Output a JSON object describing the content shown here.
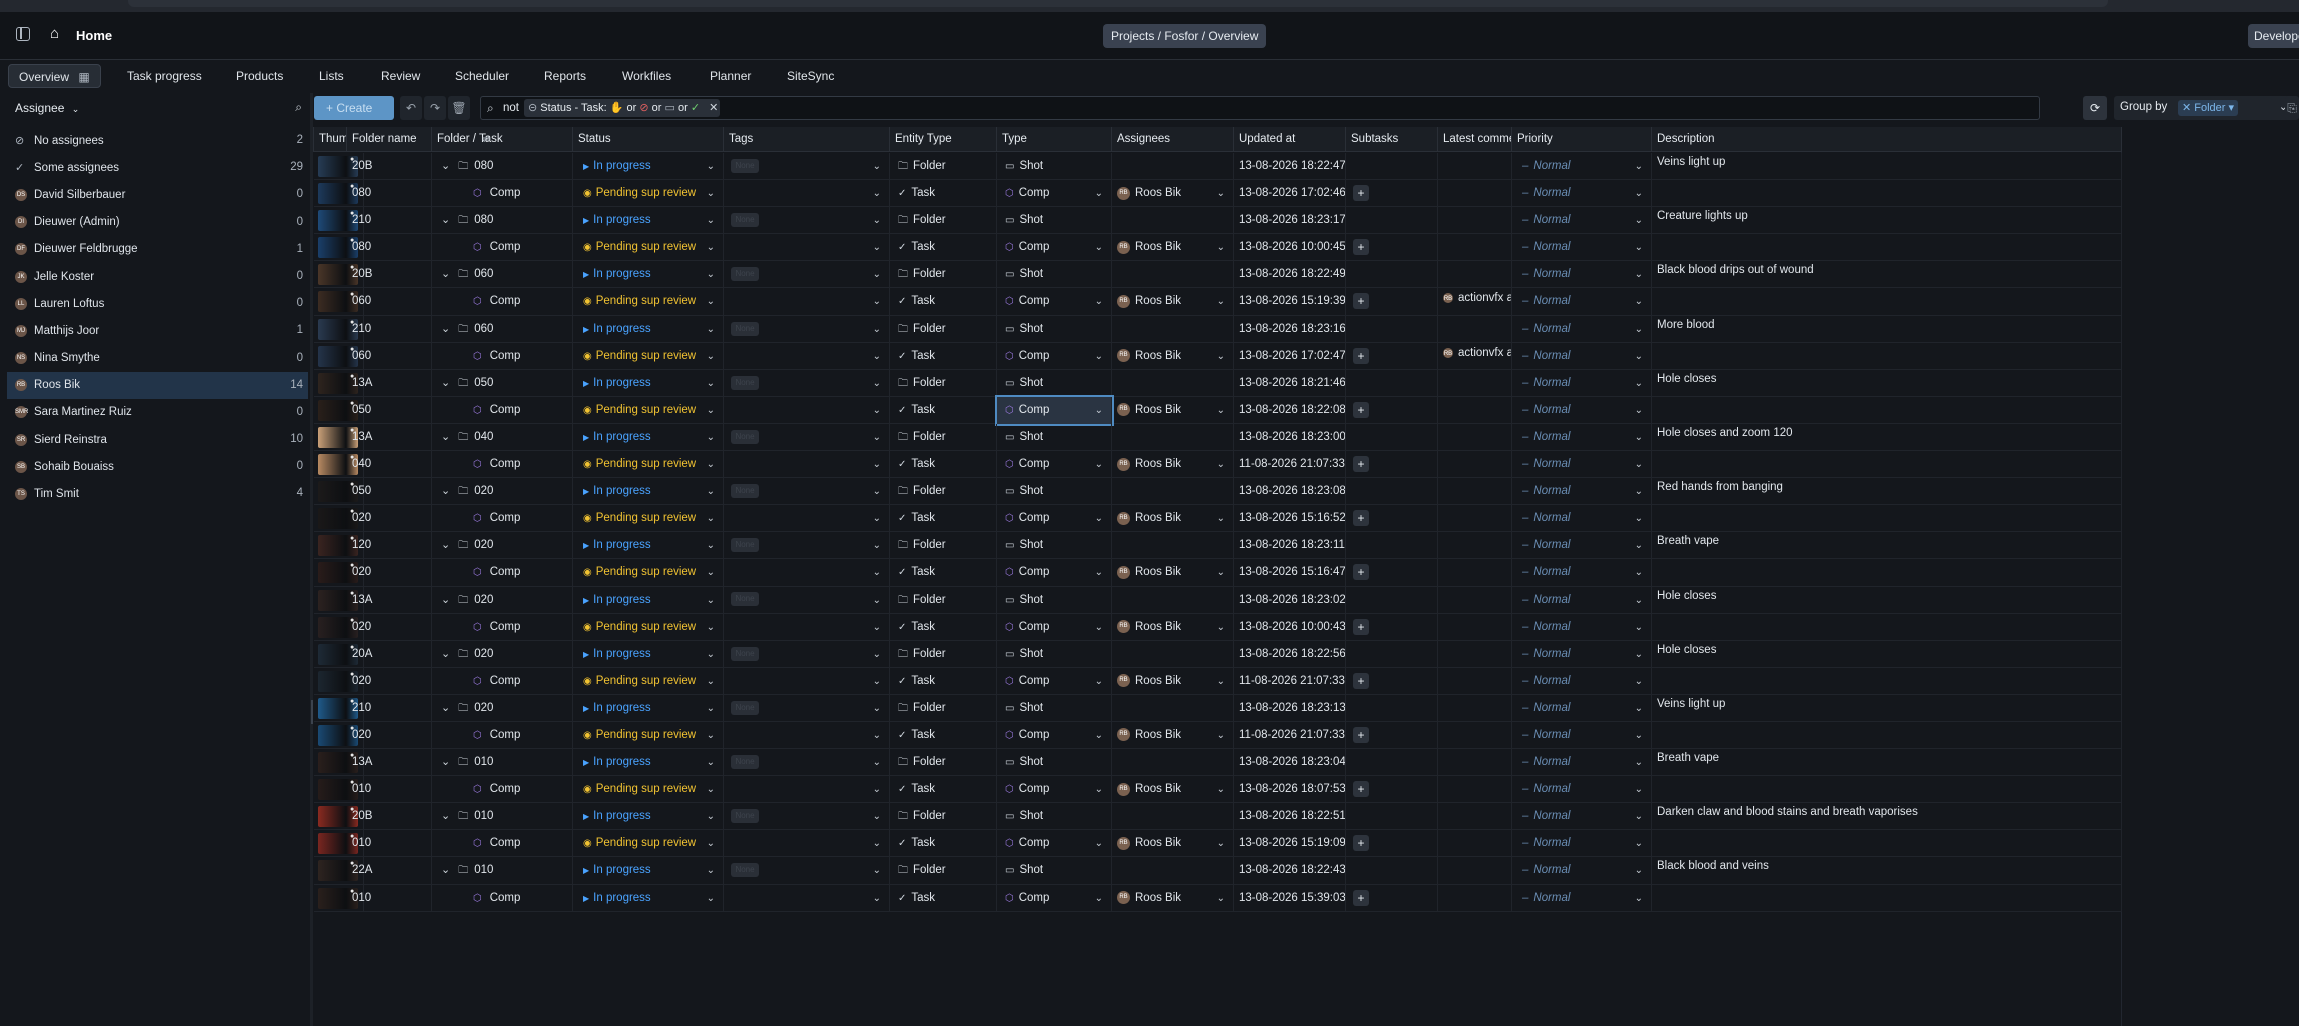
{
  "header": {
    "home_label": "Home",
    "breadcrumb": "Projects / Fosfor / Overview",
    "dev_label": "Develope"
  },
  "tabs": [
    "Overview",
    "Task progress",
    "Products",
    "Lists",
    "Review",
    "Scheduler",
    "Reports",
    "Workfiles",
    "Planner",
    "SiteSync"
  ],
  "sidebar": {
    "filter_label": "Assignee",
    "items": [
      {
        "label": "No assignees",
        "count": "2",
        "icon": "no-entry"
      },
      {
        "label": "Some assignees",
        "count": "29",
        "icon": "check"
      },
      {
        "label": "David Silberbauer",
        "count": "0",
        "initials": "DS"
      },
      {
        "label": "Dieuwer (Admin)",
        "count": "0",
        "initials": "DI"
      },
      {
        "label": "Dieuwer Feldbrugge",
        "count": "1",
        "initials": "DF"
      },
      {
        "label": "Jelle Koster",
        "count": "0",
        "initials": "JK"
      },
      {
        "label": "Lauren Loftus",
        "count": "0",
        "initials": "LL"
      },
      {
        "label": "Matthijs Joor",
        "count": "1",
        "initials": "MJ"
      },
      {
        "label": "Nina Smythe",
        "count": "0",
        "initials": "NS"
      },
      {
        "label": "Roos Bik",
        "count": "14",
        "initials": "RB",
        "selected": true
      },
      {
        "label": "Sara Martinez Ruiz",
        "count": "0",
        "initials": "SMR"
      },
      {
        "label": "Sierd Reinstra",
        "count": "10",
        "initials": "SR"
      },
      {
        "label": "Sohaib Bouaiss",
        "count": "0",
        "initials": "SB"
      },
      {
        "label": "Tim Smit",
        "count": "4",
        "initials": "TS"
      }
    ]
  },
  "toolbar": {
    "create_label": "+ Create",
    "search_not": "not",
    "chip_text": "Status - Task:",
    "chip_or": "or",
    "group_by_label": "Group by",
    "group_by_value": "Folder"
  },
  "columns": [
    "Thumbn",
    "Folder name",
    "Folder / Task",
    "Status",
    "Tags",
    "Entity Type",
    "Type",
    "Assignees",
    "Updated at",
    "Subtasks",
    "Latest comments",
    "Priority",
    "Description"
  ],
  "rows": [
    {
      "kind": "folder",
      "folder": "20B",
      "name": "080",
      "status": "In progress",
      "etype": "Folder",
      "type": "Shot",
      "updated": "13-08-2026 18:22:47",
      "priority": "Normal",
      "desc": "Veins light up",
      "thumb": "#263c55"
    },
    {
      "kind": "task",
      "folder": "080",
      "name": "Comp",
      "status": "Pending sup review",
      "etype": "Task",
      "type": "Comp",
      "assignee": "Roos Bik",
      "updated": "13-08-2026 17:02:46",
      "priority": "Normal",
      "desc": "",
      "thumb": "#1d3a5c"
    },
    {
      "kind": "folder",
      "folder": "210",
      "name": "080",
      "status": "In progress",
      "etype": "Folder",
      "type": "Shot",
      "updated": "13-08-2026 18:23:17",
      "priority": "Normal",
      "desc": "Creature lights up",
      "thumb": "#1e4a78"
    },
    {
      "kind": "task",
      "folder": "080",
      "name": "Comp",
      "status": "Pending sup review",
      "etype": "Task",
      "type": "Comp",
      "assignee": "Roos Bik",
      "updated": "13-08-2026 10:00:45",
      "priority": "Normal",
      "desc": "",
      "thumb": "#1a3f6a"
    },
    {
      "kind": "folder",
      "folder": "20B",
      "name": "060",
      "status": "In progress",
      "etype": "Folder",
      "type": "Shot",
      "updated": "13-08-2026 18:22:49",
      "priority": "Normal",
      "desc": "Black blood drips out of wound",
      "thumb": "#4a3628"
    },
    {
      "kind": "task",
      "folder": "060",
      "name": "Comp",
      "status": "Pending sup review",
      "etype": "Task",
      "type": "Comp",
      "assignee": "Roos Bik",
      "updated": "13-08-2026 15:19:39",
      "comment": "actionvfx asset",
      "priority": "Normal",
      "desc": "",
      "thumb": "#3c2c22"
    },
    {
      "kind": "folder",
      "folder": "210",
      "name": "060",
      "status": "In progress",
      "etype": "Folder",
      "type": "Shot",
      "updated": "13-08-2026 18:23:16",
      "priority": "Normal",
      "desc": "More blood",
      "thumb": "#2a3a50"
    },
    {
      "kind": "task",
      "folder": "060",
      "name": "Comp",
      "status": "Pending sup review",
      "etype": "Task",
      "type": "Comp",
      "assignee": "Roos Bik",
      "updated": "13-08-2026 17:02:47",
      "comment": "actionvfx asset",
      "priority": "Normal",
      "desc": "",
      "thumb": "#24344a"
    },
    {
      "kind": "folder",
      "folder": "13A",
      "name": "050",
      "status": "In progress",
      "etype": "Folder",
      "type": "Shot",
      "updated": "13-08-2026 18:21:46",
      "priority": "Normal",
      "desc": "Hole closes",
      "thumb": "#2e241e"
    },
    {
      "kind": "task",
      "folder": "050",
      "name": "Comp",
      "status": "Pending sup review",
      "etype": "Task",
      "type": "Comp",
      "assignee": "Roos Bik",
      "updated": "13-08-2026 18:22:08",
      "priority": "Normal",
      "desc": "",
      "thumb": "#2a201a",
      "selected_type": true
    },
    {
      "kind": "folder",
      "folder": "13A",
      "name": "040",
      "status": "In progress",
      "etype": "Folder",
      "type": "Shot",
      "updated": "13-08-2026 18:23:00",
      "priority": "Normal",
      "desc": "Hole closes and zoom 120",
      "thumb": "#c9a078"
    },
    {
      "kind": "task",
      "folder": "040",
      "name": "Comp",
      "status": "Pending sup review",
      "etype": "Task",
      "type": "Comp",
      "assignee": "Roos Bik",
      "updated": "11-08-2026 21:07:33",
      "priority": "Normal",
      "desc": "",
      "thumb": "#b88a62"
    },
    {
      "kind": "folder",
      "folder": "050",
      "name": "020",
      "status": "In progress",
      "etype": "Folder",
      "type": "Shot",
      "updated": "13-08-2026 18:23:08",
      "priority": "Normal",
      "desc": "Red hands from banging",
      "thumb": "#1c1a1a"
    },
    {
      "kind": "task",
      "folder": "020",
      "name": "Comp",
      "status": "Pending sup review",
      "etype": "Task",
      "type": "Comp",
      "assignee": "Roos Bik",
      "updated": "13-08-2026 15:16:52",
      "priority": "Normal",
      "desc": "",
      "thumb": "#1a1818"
    },
    {
      "kind": "folder",
      "folder": "120",
      "name": "020",
      "status": "In progress",
      "etype": "Folder",
      "type": "Shot",
      "updated": "13-08-2026 18:23:11",
      "priority": "Normal",
      "desc": "Breath vape",
      "thumb": "#3a2420"
    },
    {
      "kind": "task",
      "folder": "020",
      "name": "Comp",
      "status": "Pending sup review",
      "etype": "Task",
      "type": "Comp",
      "assignee": "Roos Bik",
      "updated": "13-08-2026 15:16:47",
      "priority": "Normal",
      "desc": "",
      "thumb": "#2a1c1a"
    },
    {
      "kind": "folder",
      "folder": "13A",
      "name": "020",
      "status": "In progress",
      "etype": "Folder",
      "type": "Shot",
      "updated": "13-08-2026 18:23:02",
      "priority": "Normal",
      "desc": "Hole closes",
      "thumb": "#2c2220"
    },
    {
      "kind": "task",
      "folder": "020",
      "name": "Comp",
      "status": "Pending sup review",
      "etype": "Task",
      "type": "Comp",
      "assignee": "Roos Bik",
      "updated": "13-08-2026 10:00:43",
      "priority": "Normal",
      "desc": "",
      "thumb": "#282020"
    },
    {
      "kind": "folder",
      "folder": "20A",
      "name": "020",
      "status": "In progress",
      "etype": "Folder",
      "type": "Shot",
      "updated": "13-08-2026 18:22:56",
      "priority": "Normal",
      "desc": "Hole closes",
      "thumb": "#1e2a36"
    },
    {
      "kind": "task",
      "folder": "020",
      "name": "Comp",
      "status": "Pending sup review",
      "etype": "Task",
      "type": "Comp",
      "assignee": "Roos Bik",
      "updated": "11-08-2026 21:07:33",
      "priority": "Normal",
      "desc": "",
      "thumb": "#1c2630"
    },
    {
      "kind": "folder",
      "folder": "210",
      "name": "020",
      "status": "In progress",
      "etype": "Folder",
      "type": "Shot",
      "updated": "13-08-2026 18:23:13",
      "priority": "Normal",
      "desc": "Veins light up",
      "thumb": "#1f5a8a"
    },
    {
      "kind": "task",
      "folder": "020",
      "name": "Comp",
      "status": "Pending sup review",
      "etype": "Task",
      "type": "Comp",
      "assignee": "Roos Bik",
      "updated": "11-08-2026 21:07:33",
      "priority": "Normal",
      "desc": "",
      "thumb": "#1a4a74"
    },
    {
      "kind": "folder",
      "folder": "13A",
      "name": "010",
      "status": "In progress",
      "etype": "Folder",
      "type": "Shot",
      "updated": "13-08-2026 18:23:04",
      "priority": "Normal",
      "desc": "Breath vape",
      "thumb": "#2a1f1c"
    },
    {
      "kind": "task",
      "folder": "010",
      "name": "Comp",
      "status": "Pending sup review",
      "etype": "Task",
      "type": "Comp",
      "assignee": "Roos Bik",
      "updated": "13-08-2026 18:07:53",
      "priority": "Normal",
      "desc": "",
      "thumb": "#261c1a"
    },
    {
      "kind": "folder",
      "folder": "20B",
      "name": "010",
      "status": "In progress",
      "etype": "Folder",
      "type": "Shot",
      "updated": "13-08-2026 18:22:51",
      "priority": "Normal",
      "desc": "Darken claw and blood stains and breath vaporises",
      "thumb": "#8a2a20"
    },
    {
      "kind": "task",
      "folder": "010",
      "name": "Comp",
      "status": "Pending sup review",
      "etype": "Task",
      "type": "Comp",
      "assignee": "Roos Bik",
      "updated": "13-08-2026 15:19:09",
      "priority": "Normal",
      "desc": "",
      "thumb": "#7a2620"
    },
    {
      "kind": "folder",
      "folder": "22A",
      "name": "010",
      "status": "In progress",
      "etype": "Folder",
      "type": "Shot",
      "updated": "13-08-2026 18:22:43",
      "priority": "Normal",
      "desc": "Black blood and veins",
      "thumb": "#2e2420"
    },
    {
      "kind": "task",
      "folder": "010",
      "name": "Comp",
      "status": "In progress",
      "etype": "Task",
      "type": "Comp",
      "assignee": "Roos Bik",
      "updated": "13-08-2026 15:39:03",
      "priority": "Normal",
      "desc": "",
      "thumb": "#2a201c"
    }
  ],
  "tag_placeholder": "None",
  "priority_prefix": "–",
  "colors": {
    "in_progress": "#4aa3ff",
    "pending": "#f0c232",
    "accent": "#5d95c6",
    "selected_row": "#223449"
  }
}
